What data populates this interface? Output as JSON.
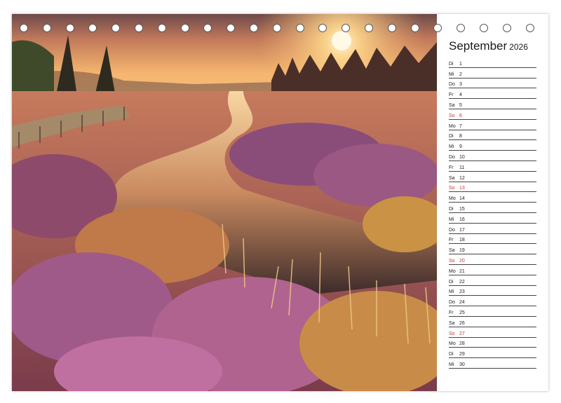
{
  "calendar": {
    "month": "September",
    "year": "2026",
    "days": [
      {
        "name": "Di",
        "num": "1",
        "sunday": false
      },
      {
        "name": "Mi",
        "num": "2",
        "sunday": false
      },
      {
        "name": "Do",
        "num": "3",
        "sunday": false
      },
      {
        "name": "Fr",
        "num": "4",
        "sunday": false
      },
      {
        "name": "Sa",
        "num": "5",
        "sunday": false
      },
      {
        "name": "So",
        "num": "6",
        "sunday": true
      },
      {
        "name": "Mo",
        "num": "7",
        "sunday": false
      },
      {
        "name": "Di",
        "num": "8",
        "sunday": false
      },
      {
        "name": "Mi",
        "num": "9",
        "sunday": false
      },
      {
        "name": "Do",
        "num": "10",
        "sunday": false
      },
      {
        "name": "Fr",
        "num": "11",
        "sunday": false
      },
      {
        "name": "Sa",
        "num": "12",
        "sunday": false
      },
      {
        "name": "So",
        "num": "13",
        "sunday": true
      },
      {
        "name": "Mo",
        "num": "14",
        "sunday": false
      },
      {
        "name": "Di",
        "num": "15",
        "sunday": false
      },
      {
        "name": "Mi",
        "num": "16",
        "sunday": false
      },
      {
        "name": "Do",
        "num": "17",
        "sunday": false
      },
      {
        "name": "Fr",
        "num": "18",
        "sunday": false
      },
      {
        "name": "Sa",
        "num": "19",
        "sunday": false
      },
      {
        "name": "So",
        "num": "20",
        "sunday": true
      },
      {
        "name": "Mo",
        "num": "21",
        "sunday": false
      },
      {
        "name": "Di",
        "num": "22",
        "sunday": false
      },
      {
        "name": "Mi",
        "num": "23",
        "sunday": false
      },
      {
        "name": "Do",
        "num": "24",
        "sunday": false
      },
      {
        "name": "Fr",
        "num": "25",
        "sunday": false
      },
      {
        "name": "Sa",
        "num": "26",
        "sunday": false
      },
      {
        "name": "So",
        "num": "27",
        "sunday": true
      },
      {
        "name": "Mo",
        "num": "28",
        "sunday": false
      },
      {
        "name": "Di",
        "num": "29",
        "sunday": false
      },
      {
        "name": "Mi",
        "num": "30",
        "sunday": false
      }
    ]
  },
  "colors": {
    "sunday": "#c0392b",
    "heather": "#9c4f7e",
    "sky": "#f3b06a"
  }
}
